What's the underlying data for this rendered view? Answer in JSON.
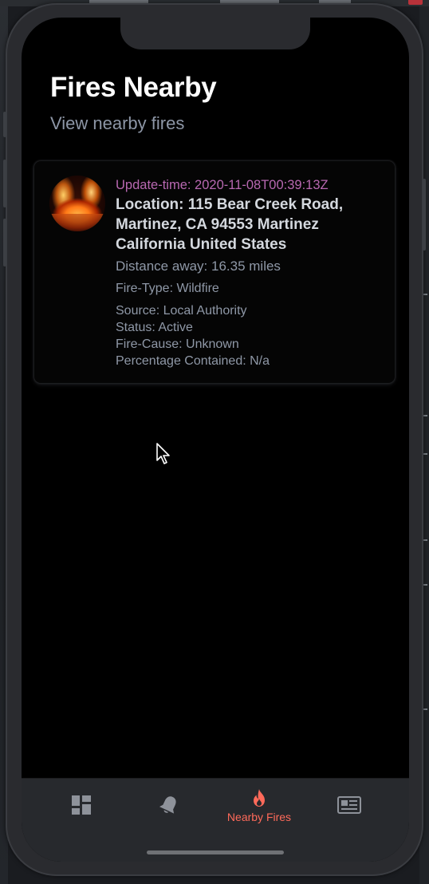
{
  "header": {
    "title": "Fires Nearby",
    "subtitle": "View nearby fires"
  },
  "fires": [
    {
      "update_time": "Update-time: 2020-11-08T00:39:13Z",
      "location": "Location: 115 Bear Creek Road, Martinez, CA 94553 Martinez California United States",
      "distance": "Distance away: 16.35 miles",
      "fire_type": "Fire-Type: Wildfire",
      "source": "Source: Local Authority",
      "status": "Status: Active",
      "fire_cause": "Fire-Cause: Unknown",
      "percentage_contained": "Percentage Contained: N/a"
    }
  ],
  "tabbar": {
    "tabs": [
      {
        "icon": "dashboard-icon",
        "label": "",
        "active": false
      },
      {
        "icon": "bell-icon",
        "label": "",
        "active": false
      },
      {
        "icon": "flame-icon",
        "label": "Nearby Fires",
        "active": true
      },
      {
        "icon": "news-icon",
        "label": "",
        "active": false
      }
    ]
  },
  "colors": {
    "background": "#000000",
    "active_tab": "#ff6a5a",
    "inactive_icon": "#8e929a",
    "update_time": "#b868b1",
    "title": "#ffffff",
    "secondary_text": "#8f98a7"
  }
}
